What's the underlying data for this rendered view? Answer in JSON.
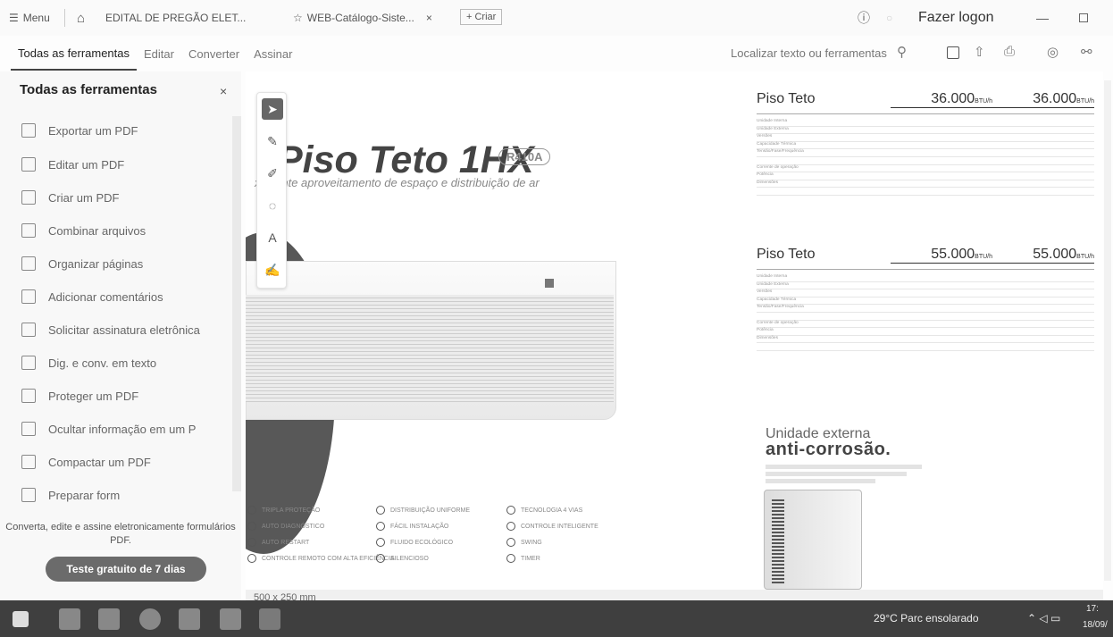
{
  "titlebar": {
    "menu_label": "Menu",
    "tabs": [
      {
        "label": "EDITAL DE PREGÃO ELET..."
      },
      {
        "label": "WEB-Catálogo-Siste...",
        "close": "×"
      }
    ],
    "new_tab": "+ Criar",
    "signin": "Fazer logon",
    "minimize": "—"
  },
  "subnav": {
    "tabs": [
      "Todas as ferramentas",
      "Editar",
      "Converter",
      "Assinar"
    ],
    "search_placeholder": "Localizar texto ou ferramentas"
  },
  "sidebar": {
    "title": "Todas as ferramentas",
    "close": "×",
    "tools": [
      "Exportar um PDF",
      "Editar um PDF",
      "Criar um PDF",
      "Combinar arquivos",
      "Organizar páginas",
      "Adicionar comentários",
      "Solicitar assinatura eletrônica",
      "Dig. e conv. em texto",
      "Proteger um PDF",
      "Ocultar informação em um P",
      "Compactar um PDF",
      "Preparar form"
    ],
    "footer": "Converta, edite e assine eletronicamente formulários PDF.",
    "trial_button": "Teste gratuito de 7 dias"
  },
  "document": {
    "title": "Piso Teto 1HX",
    "badge": "R410A",
    "subtitle": "xcelente aproveitamento de espaço e distribuição de ar",
    "features": [
      "TRIPLA PROTEÇÃO",
      "AUTO DIAGNÓSTICO",
      "AUTO RESTART",
      "CONTROLE REMOTO COM ALTA EFICIÊNCIA",
      "DISTRIBUIÇÃO UNIFORME",
      "FÁCIL INSTALAÇÃO",
      "FLUIDO ECOLÓGICO",
      "SILENCIOSO",
      "TECNOLOGIA 4 VIAS",
      "CONTROLE INTELIGENTE",
      "SWING",
      "TIMER"
    ],
    "spec_tables": [
      {
        "name": "Piso Teto",
        "capacities": [
          {
            "value": "36.000",
            "unit": "BTU/h"
          },
          {
            "value": "36.000",
            "unit": "BTU/h"
          }
        ],
        "rows": [
          [
            "Unidade Interna",
            "",
            ""
          ],
          [
            "Unidade Externa",
            "",
            ""
          ],
          [
            "Versões",
            "",
            ""
          ],
          [
            "Capacidade Térmica",
            "",
            ""
          ],
          [
            "Tensão/Fase/Frequência",
            "",
            ""
          ],
          [
            "",
            "",
            ""
          ],
          [
            "Corrente de operação",
            "",
            ""
          ],
          [
            "Potência",
            "",
            ""
          ],
          [
            "Dimensões",
            "",
            ""
          ],
          [
            "",
            "",
            ""
          ]
        ]
      },
      {
        "name": "Piso Teto",
        "capacities": [
          {
            "value": "55.000",
            "unit": "BTU/h"
          },
          {
            "value": "55.000",
            "unit": "BTU/h"
          }
        ],
        "rows": [
          [
            "Unidade Interna",
            "",
            ""
          ],
          [
            "Unidade Externa",
            "",
            ""
          ],
          [
            "Versões",
            "",
            ""
          ],
          [
            "Capacidade Térmica",
            "",
            ""
          ],
          [
            "Tensão/Fase/Frequência",
            "",
            ""
          ],
          [
            "",
            "",
            ""
          ],
          [
            "Corrente de operação",
            "",
            ""
          ],
          [
            "Potência",
            "",
            ""
          ],
          [
            "Dimensões",
            "",
            ""
          ],
          [
            "",
            "",
            ""
          ]
        ]
      }
    ],
    "external_heading": "Unidade externa",
    "external_heading2": "anti-corrosão."
  },
  "status": {
    "page_size": "500 x 250 mm"
  },
  "taskbar": {
    "weather": "29°C  Parc ensolarado",
    "time": "17:",
    "date": "18/09/"
  }
}
